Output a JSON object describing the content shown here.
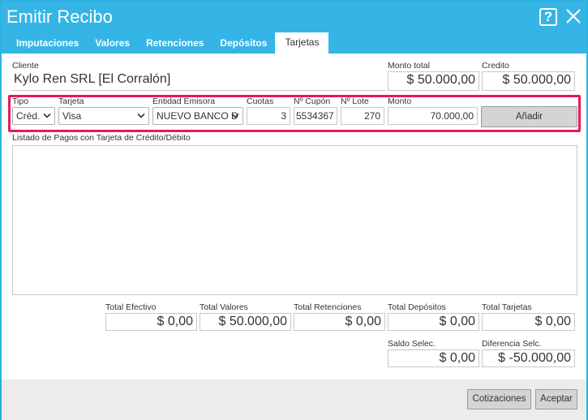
{
  "window": {
    "title": "Emitir Recibo"
  },
  "tabs": [
    {
      "label": "Imputaciones"
    },
    {
      "label": "Valores"
    },
    {
      "label": "Retenciones"
    },
    {
      "label": "Depósitos"
    },
    {
      "label": "Tarjetas"
    }
  ],
  "cliente": {
    "label": "Cliente",
    "value": "Kylo Ren SRL [El Corralón]"
  },
  "monto_total": {
    "label": "Monto total",
    "value": "$ 50.000,00"
  },
  "credito": {
    "label": "Credito",
    "value": "$ 50.000,00"
  },
  "form": {
    "tipo": {
      "label": "Tipo",
      "value": "Créd."
    },
    "tarjeta": {
      "label": "Tarjeta",
      "value": "Visa"
    },
    "entidad": {
      "label": "Entidad Emisora",
      "value": "NUEVO BANCO D"
    },
    "cuotas": {
      "label": "Cuotas",
      "value": "3"
    },
    "cupon": {
      "label": "Nº Cupón",
      "value": "5534367"
    },
    "lote": {
      "label": "Nº Lote",
      "value": "270"
    },
    "monto": {
      "label": "Monto",
      "value": "70.000,00"
    },
    "add_label": "Añadir"
  },
  "listado": {
    "label": "Listado de Pagos con Tarjeta de Crédito/Débito"
  },
  "totals": {
    "efectivo": {
      "label": "Total Efectivo",
      "value": "$ 0,00"
    },
    "valores": {
      "label": "Total Valores",
      "value": "$ 50.000,00"
    },
    "retenciones": {
      "label": "Total Retenciones",
      "value": "$ 0,00"
    },
    "depositos": {
      "label": "Total Depósitos",
      "value": "$ 0,00"
    },
    "tarjetas": {
      "label": "Total Tarjetas",
      "value": "$ 0,00"
    },
    "saldo": {
      "label": "Saldo Selec.",
      "value": "$ 0,00"
    },
    "diferencia": {
      "label": "Diferencia Selc.",
      "value": "$ -50.000,00"
    }
  },
  "footer": {
    "cotizaciones_label": "Cotizaciones",
    "aceptar_label": "Aceptar"
  },
  "colors": {
    "titlebar": "#35b5e5",
    "highlight": "#e6195e"
  }
}
